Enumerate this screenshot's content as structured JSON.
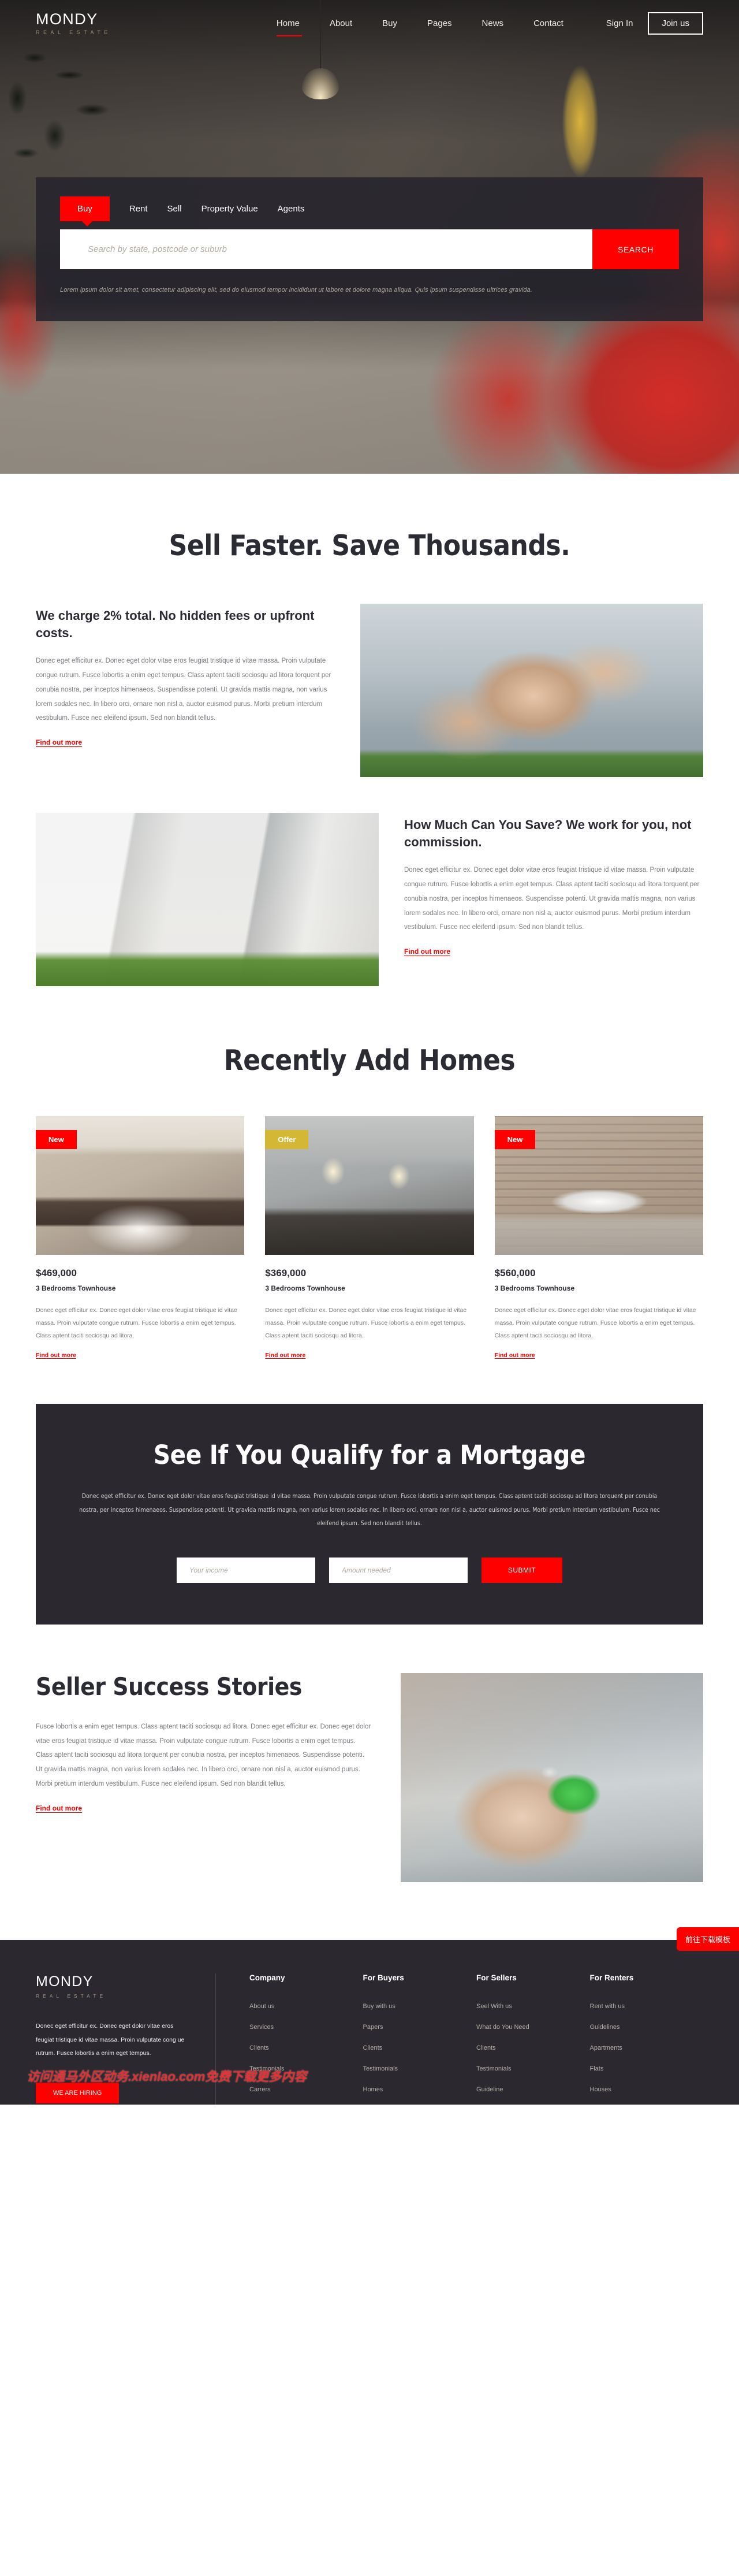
{
  "brand": {
    "name": "MONDY",
    "tagline": "REAL ESTATE"
  },
  "nav": {
    "links": [
      {
        "label": "Home",
        "active": true
      },
      {
        "label": "About",
        "active": false
      },
      {
        "label": "Buy",
        "active": false
      },
      {
        "label": "Pages",
        "active": false
      },
      {
        "label": "News",
        "active": false
      },
      {
        "label": "Contact",
        "active": false
      }
    ],
    "signin": "Sign In",
    "join": "Join us"
  },
  "hero_search": {
    "tabs": [
      "Buy",
      "Rent",
      "Sell",
      "Property Value",
      "Agents"
    ],
    "active_tab": "Buy",
    "placeholder": "Search by state, postcode or suburb",
    "value": "",
    "button": "SEARCH",
    "note": "Lorem ipsum dolor sit amet, consectetur adipiscing elit, sed do eiusmod tempor incididunt ut labore et dolore magna aliqua. Quis ipsum suspendisse ultrices gravida."
  },
  "sell_section": {
    "title": "Sell Faster. Save Thousands.",
    "blocks": [
      {
        "heading": "We charge 2% total. No hidden fees or upfront costs.",
        "body": "Donec eget efficitur ex. Donec eget dolor vitae eros feugiat tristique id vitae massa. Proin vulputate congue rutrum. Fusce lobortis a enim eget tempus. Class aptent taciti sociosqu ad litora torquent per conubia nostra, per inceptos himenaeos. Suspendisse potenti. Ut gravida mattis magna, non varius lorem sodales nec. In libero orci, ornare non nisl a, auctor euismod purus. Morbi pretium interdum vestibulum. Fusce nec eleifend ipsum. Sed non blandit tellus.",
        "link": "Find out more"
      },
      {
        "heading": "How Much Can You Save? We work for you, not commission.",
        "body": "Donec eget efficitur ex. Donec eget dolor vitae eros feugiat tristique id vitae massa. Proin vulputate congue rutrum. Fusce lobortis a enim eget tempus. Class aptent taciti sociosqu ad litora torquent per conubia nostra, per inceptos himenaeos. Suspendisse potenti. Ut gravida mattis magna, non varius lorem sodales nec. In libero orci, ornare non nisl a, auctor euismod purus. Morbi pretium interdum vestibulum. Fusce nec eleifend ipsum. Sed non blandit tellus.",
        "link": "Find out more"
      }
    ]
  },
  "homes": {
    "title": "Recently Add Homes",
    "cards": [
      {
        "badge": "New",
        "badge_color": "#ff0000",
        "price": "$469,000",
        "subtitle": "3 Bedrooms Townhouse",
        "desc": "Donec eget efficitur ex. Donec eget dolor vitae eros feugiat tristique id vitae massa. Proin vulputate congue rutrum. Fusce lobortis a enim eget tempus. Class aptent taciti sociosqu ad litora.",
        "link": "Find out more"
      },
      {
        "badge": "Offer",
        "badge_color": "#d4b835",
        "price": "$369,000",
        "subtitle": "3 Bedrooms Townhouse",
        "desc": "Donec eget efficitur ex. Donec eget dolor vitae eros feugiat tristique id vitae massa. Proin vulputate congue rutrum. Fusce lobortis a enim eget tempus. Class aptent taciti sociosqu ad litora.",
        "link": "Find out more"
      },
      {
        "badge": "New",
        "badge_color": "#ff0000",
        "price": "$560,000",
        "subtitle": "3 Bedrooms Townhouse",
        "desc": "Donec eget efficitur ex. Donec eget dolor vitae eros feugiat tristique id vitae massa. Proin vulputate congue rutrum. Fusce lobortis a enim eget tempus. Class aptent taciti sociosqu ad litora.",
        "link": "Find out more"
      }
    ]
  },
  "mortgage": {
    "title": "See If You Qualify for a Mortgage",
    "body": "Donec eget efficitur ex. Donec eget dolor vitae eros feugiat tristique id vitae massa. Proin vulputate congue rutrum. Fusce lobortis a enim eget tempus. Class aptent taciti sociosqu ad litora torquent per conubia nostra, per inceptos himenaeos. Suspendisse potenti. Ut gravida mattis magna, non varius lorem sodales nec. In libero orci, ornare non nisl a, auctor euismod purus. Morbi pretium interdum vestibulum. Fusce nec eleifend ipsum. Sed non blandit tellus.",
    "income_placeholder": "Your income",
    "income_value": "",
    "amount_placeholder": "Amount needed",
    "amount_value": "",
    "submit": "SUBMIT"
  },
  "stories": {
    "title": "Seller Success Stories",
    "body": "Fusce lobortis a enim eget tempus. Class aptent taciti sociosqu ad litora. Donec eget efficitur ex. Donec eget dolor vitae eros feugiat tristique id vitae massa. Proin vulputate congue rutrum. Fusce lobortis a enim eget tempus. Class aptent taciti sociosqu ad litora torquent per conubia nostra, per inceptos himenaeos. Suspendisse potenti. Ut gravida mattis magna, non varius lorem sodales nec. In libero orci, ornare non nisl a, auctor euismod purus. Morbi pretium interdum vestibulum. Fusce nec eleifend ipsum. Sed non blandit tellus.",
    "link": "Find out more"
  },
  "footer": {
    "desc": "Donec eget efficitur ex. Donec eget dolor vitae eros feugiat tristique id vitae massa. Proin vulputate cong ue rutrum. Fusce lobortis a enim eget tempus.",
    "hiring": "WE ARE HIRING",
    "columns": [
      {
        "title": "Company",
        "links": [
          "About us",
          "Services",
          "Clients",
          "Testimonials",
          "Carrers"
        ]
      },
      {
        "title": "For Buyers",
        "links": [
          "Buy with us",
          "Papers",
          "Clients",
          "Testimonials",
          "Homes"
        ]
      },
      {
        "title": "For Sellers",
        "links": [
          "Seel With us",
          "What do You Need",
          "Clients",
          "Testimonials",
          "Guideline"
        ]
      },
      {
        "title": "For Renters",
        "links": [
          "Rent with us",
          "Guidelines",
          "Apartments",
          "Flats",
          "Houses"
        ]
      }
    ]
  },
  "overlay": {
    "watermark": "访问通马外区动务.xienlao.com免费下载更多内容",
    "download_button": "前往下载模板"
  },
  "colors": {
    "accent": "#ff0000",
    "dark": "#2b2830",
    "offer": "#d4b835",
    "gold": "#9c8f76"
  }
}
